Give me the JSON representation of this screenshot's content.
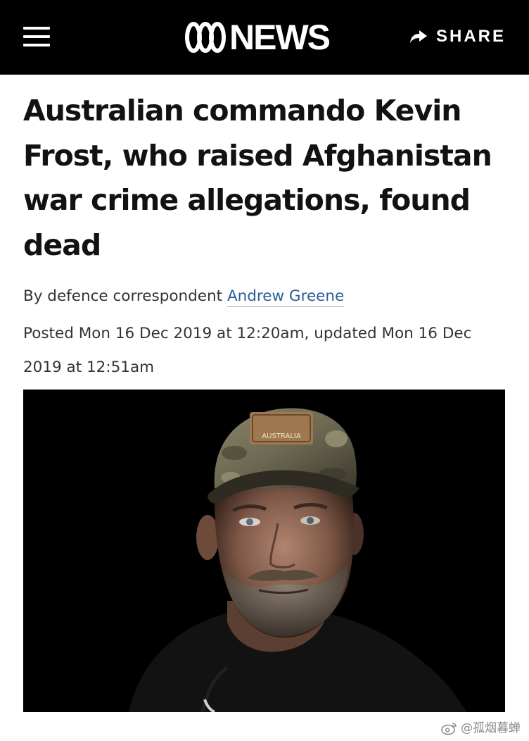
{
  "header": {
    "menu_icon": "hamburger-menu-icon",
    "logo_text": "NEWS",
    "logo_icon": "abc-lissajous-logo",
    "share_icon": "share-arrow-icon",
    "share_label": "SHARE"
  },
  "article": {
    "headline": "Australian commando Kevin Frost, who raised Afghanistan war crime allegations, found dead",
    "byline_prefix": "By defence correspondent",
    "author": "Andrew Greene",
    "dateline": "Posted Mon 16 Dec 2019 at 12:20am, updated Mon 16 Dec 2019 at 12:51am",
    "photo_cap_text": "AUSTRALIA"
  },
  "watermark": {
    "icon": "weibo-icon",
    "text": "@孤烟暮蝉"
  },
  "colors": {
    "topbar": "#000000",
    "link": "#2a5d97",
    "headline": "#121212"
  }
}
